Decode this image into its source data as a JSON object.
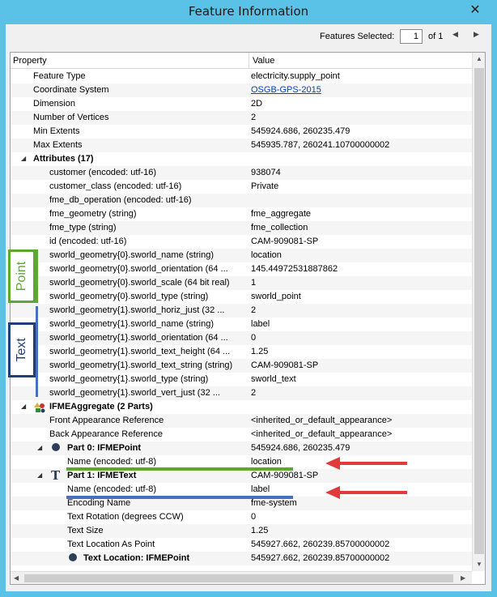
{
  "window": {
    "title": "Feature Information",
    "close_glyph": "✕"
  },
  "toolbar": {
    "features_selected_label": "Features Selected:",
    "current": "1",
    "of_label": "of 1",
    "prev_glyph": "◀",
    "next_glyph": "▶"
  },
  "grid": {
    "headers": {
      "property": "Property",
      "value": "Value"
    },
    "rows": [
      {
        "p": "Feature Type",
        "v": "electricity.supply_point",
        "indent": 28
      },
      {
        "p": "Coordinate System",
        "v": "OSGB-GPS-2015",
        "indent": 28,
        "link": true
      },
      {
        "p": "Dimension",
        "v": "2D",
        "indent": 28
      },
      {
        "p": "Number of Vertices",
        "v": "2",
        "indent": 28
      },
      {
        "p": "Min Extents",
        "v": "545924.686, 260235.479",
        "indent": 28
      },
      {
        "p": "Max Extents",
        "v": "545935.787, 260241.10700000002",
        "indent": 28
      },
      {
        "p": "Attributes (17)",
        "v": "",
        "indent": 28,
        "bold": true,
        "expander": true,
        "expander_at": 13
      },
      {
        "p": "customer (encoded: utf-16)",
        "v": "938074",
        "indent": 48
      },
      {
        "p": "customer_class (encoded: utf-16)",
        "v": "Private",
        "indent": 48
      },
      {
        "p": "fme_db_operation (encoded: utf-16)",
        "v": "",
        "indent": 48
      },
      {
        "p": "fme_geometry (string)",
        "v": "fme_aggregate",
        "indent": 48
      },
      {
        "p": "fme_type (string)",
        "v": "fme_collection",
        "indent": 48
      },
      {
        "p": "id (encoded: utf-16)",
        "v": "CAM-909081-SP",
        "indent": 48
      },
      {
        "p": "sworld_geometry{0}.sworld_name (string)",
        "v": "location",
        "indent": 48
      },
      {
        "p": "sworld_geometry{0}.sworld_orientation (64 ...",
        "v": "145.44972531887862",
        "indent": 48
      },
      {
        "p": "sworld_geometry{0}.sworld_scale (64 bit real)",
        "v": "1",
        "indent": 48
      },
      {
        "p": "sworld_geometry{0}.sworld_type (string)",
        "v": "sworld_point",
        "indent": 48
      },
      {
        "p": "sworld_geometry{1}.sworld_horiz_just (32 ...",
        "v": "2",
        "indent": 48
      },
      {
        "p": "sworld_geometry{1}.sworld_name (string)",
        "v": "label",
        "indent": 48
      },
      {
        "p": "sworld_geometry{1}.sworld_orientation (64 ...",
        "v": "0",
        "indent": 48
      },
      {
        "p": "sworld_geometry{1}.sworld_text_height (64 ...",
        "v": "1.25",
        "indent": 48
      },
      {
        "p": "sworld_geometry{1}.sworld_text_string (string)",
        "v": "CAM-909081-SP",
        "indent": 48
      },
      {
        "p": "sworld_geometry{1}.sworld_type (string)",
        "v": "sworld_text",
        "indent": 48
      },
      {
        "p": "sworld_geometry{1}.sworld_vert_just (32 ...",
        "v": "2",
        "indent": 48
      },
      {
        "p": "IFMEAggregate (2 Parts)",
        "v": "",
        "indent": 48,
        "bold": true,
        "expander": true,
        "expander_at": 13,
        "icon": "aggregate-icon",
        "icon_at": 28
      },
      {
        "p": "Front Appearance Reference",
        "v": "<inherited_or_default_appearance>",
        "indent": 48
      },
      {
        "p": "Back Appearance Reference",
        "v": "<inherited_or_default_appearance>",
        "indent": 48
      },
      {
        "p": "Part 0: IFMEPoint",
        "v": "545924.686, 260235.479",
        "indent": 70,
        "bold": true,
        "expander": true,
        "expander_at": 33,
        "icon": "point-icon",
        "icon_at": 51
      },
      {
        "p": "Name (encoded: utf-8)",
        "v": "location",
        "indent": 70
      },
      {
        "p": "Part 1: IFMEText",
        "v": "CAM-909081-SP",
        "indent": 70,
        "bold": true,
        "expander": true,
        "expander_at": 33,
        "icon": "text-icon",
        "icon_at": 50
      },
      {
        "p": "Name (encoded: utf-8)",
        "v": "label",
        "indent": 70
      },
      {
        "p": "Encoding Name",
        "v": "fme-system",
        "indent": 70
      },
      {
        "p": "Text Rotation (degrees CCW)",
        "v": "0",
        "indent": 70
      },
      {
        "p": "Text Size",
        "v": "1.25",
        "indent": 70
      },
      {
        "p": "Text Location As Point",
        "v": "545927.662, 260239.85700000002",
        "indent": 70
      },
      {
        "p": "Text Location: IFMEPoint",
        "v": "545927.662, 260239.85700000002",
        "indent": 90,
        "bold": true,
        "icon": "point-icon",
        "icon_at": 72
      }
    ]
  },
  "annotations": {
    "point_label": "Point",
    "text_label": "Text",
    "point_color": "#5ea832",
    "text_color": "#1f3f78",
    "arrow_color": "#e03a3a"
  },
  "colors": {
    "titlebar": "#5bc2e7",
    "link": "#0044cc",
    "icon": "#2d3e57"
  }
}
